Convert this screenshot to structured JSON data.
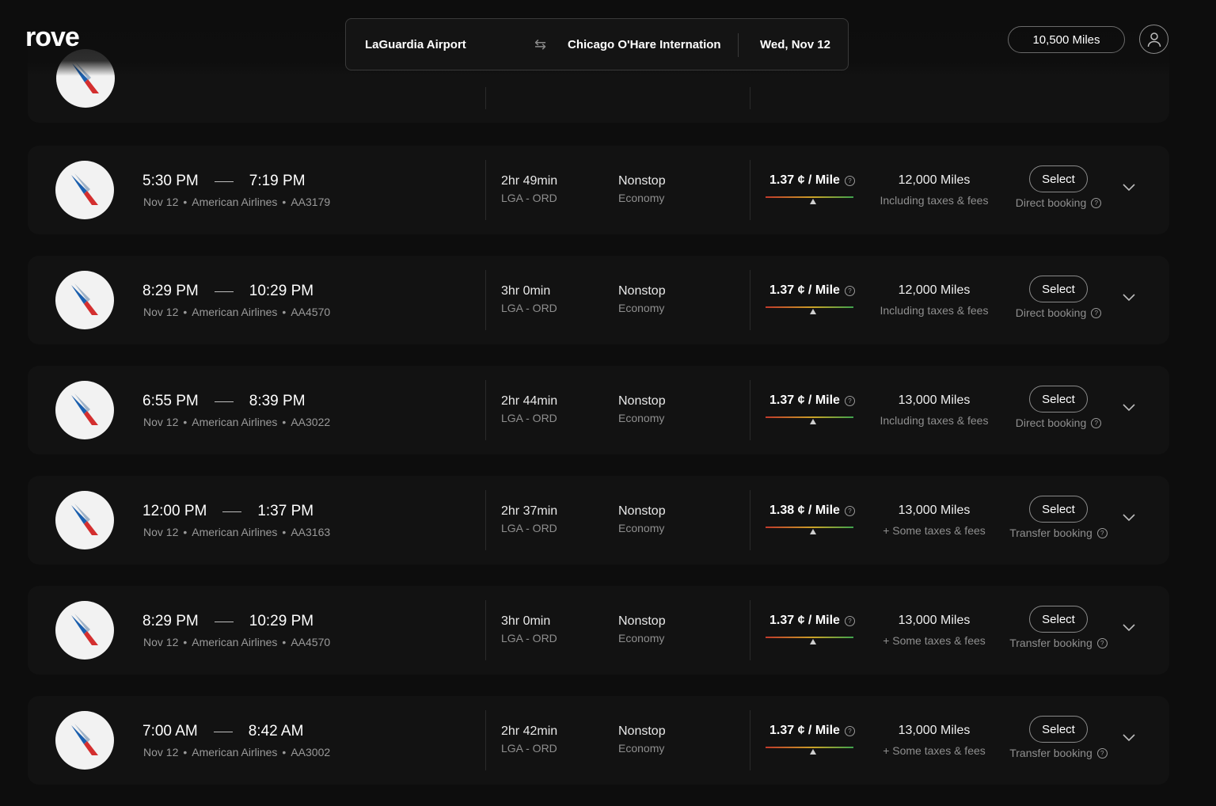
{
  "brand": {
    "logo_text": "rove"
  },
  "search": {
    "from": "LaGuardia Airport",
    "swap_icon": "swap-arrows-icon",
    "to": "Chicago O'Hare Internation",
    "date": "Wed, Nov 12"
  },
  "account": {
    "miles_balance": "10,500 Miles",
    "profile_icon": "user-icon"
  },
  "colors": {
    "background": "#0d0d0d",
    "card": "#121212",
    "value_bar": [
      "#c0392b",
      "#c9a227",
      "#3fa34d"
    ],
    "aa_blue": "#1b5fae",
    "aa_red": "#d32f2f"
  },
  "flights": [
    {
      "depart": "5:30 PM",
      "arrive": "7:19 PM",
      "date": "Nov 12",
      "airline": "American Airlines",
      "flight_no": "AA3179",
      "duration": "2hr 49min",
      "route": "LGA - ORD",
      "stops": "Nonstop",
      "cabin": "Economy",
      "cpm": "1.37 ¢ / Mile",
      "cpm_marker": 0.54,
      "miles": "12,000 Miles",
      "taxes": "Including taxes & fees",
      "select_label": "Select",
      "booking_type": "Direct booking"
    },
    {
      "depart": "8:29 PM",
      "arrive": "10:29 PM",
      "date": "Nov 12",
      "airline": "American Airlines",
      "flight_no": "AA4570",
      "duration": "3hr 0min",
      "route": "LGA - ORD",
      "stops": "Nonstop",
      "cabin": "Economy",
      "cpm": "1.37 ¢ / Mile",
      "cpm_marker": 0.54,
      "miles": "12,000 Miles",
      "taxes": "Including taxes & fees",
      "select_label": "Select",
      "booking_type": "Direct booking"
    },
    {
      "depart": "6:55 PM",
      "arrive": "8:39 PM",
      "date": "Nov 12",
      "airline": "American Airlines",
      "flight_no": "AA3022",
      "duration": "2hr 44min",
      "route": "LGA - ORD",
      "stops": "Nonstop",
      "cabin": "Economy",
      "cpm": "1.37 ¢ / Mile",
      "cpm_marker": 0.54,
      "miles": "13,000 Miles",
      "taxes": "Including taxes & fees",
      "select_label": "Select",
      "booking_type": "Direct booking"
    },
    {
      "depart": "12:00 PM",
      "arrive": "1:37 PM",
      "date": "Nov 12",
      "airline": "American Airlines",
      "flight_no": "AA3163",
      "duration": "2hr 37min",
      "route": "LGA - ORD",
      "stops": "Nonstop",
      "cabin": "Economy",
      "cpm": "1.38 ¢ / Mile",
      "cpm_marker": 0.54,
      "miles": "13,000 Miles",
      "taxes": "+ Some taxes & fees",
      "select_label": "Select",
      "booking_type": "Transfer booking"
    },
    {
      "depart": "8:29 PM",
      "arrive": "10:29 PM",
      "date": "Nov 12",
      "airline": "American Airlines",
      "flight_no": "AA4570",
      "duration": "3hr 0min",
      "route": "LGA - ORD",
      "stops": "Nonstop",
      "cabin": "Economy",
      "cpm": "1.37 ¢ / Mile",
      "cpm_marker": 0.54,
      "miles": "13,000 Miles",
      "taxes": "+ Some taxes & fees",
      "select_label": "Select",
      "booking_type": "Transfer booking"
    },
    {
      "depart": "7:00 AM",
      "arrive": "8:42 AM",
      "date": "Nov 12",
      "airline": "American Airlines",
      "flight_no": "AA3002",
      "duration": "2hr 42min",
      "route": "LGA - ORD",
      "stops": "Nonstop",
      "cabin": "Economy",
      "cpm": "1.37 ¢ / Mile",
      "cpm_marker": 0.54,
      "miles": "13,000 Miles",
      "taxes": "+ Some taxes & fees",
      "select_label": "Select",
      "booking_type": "Transfer booking"
    }
  ]
}
